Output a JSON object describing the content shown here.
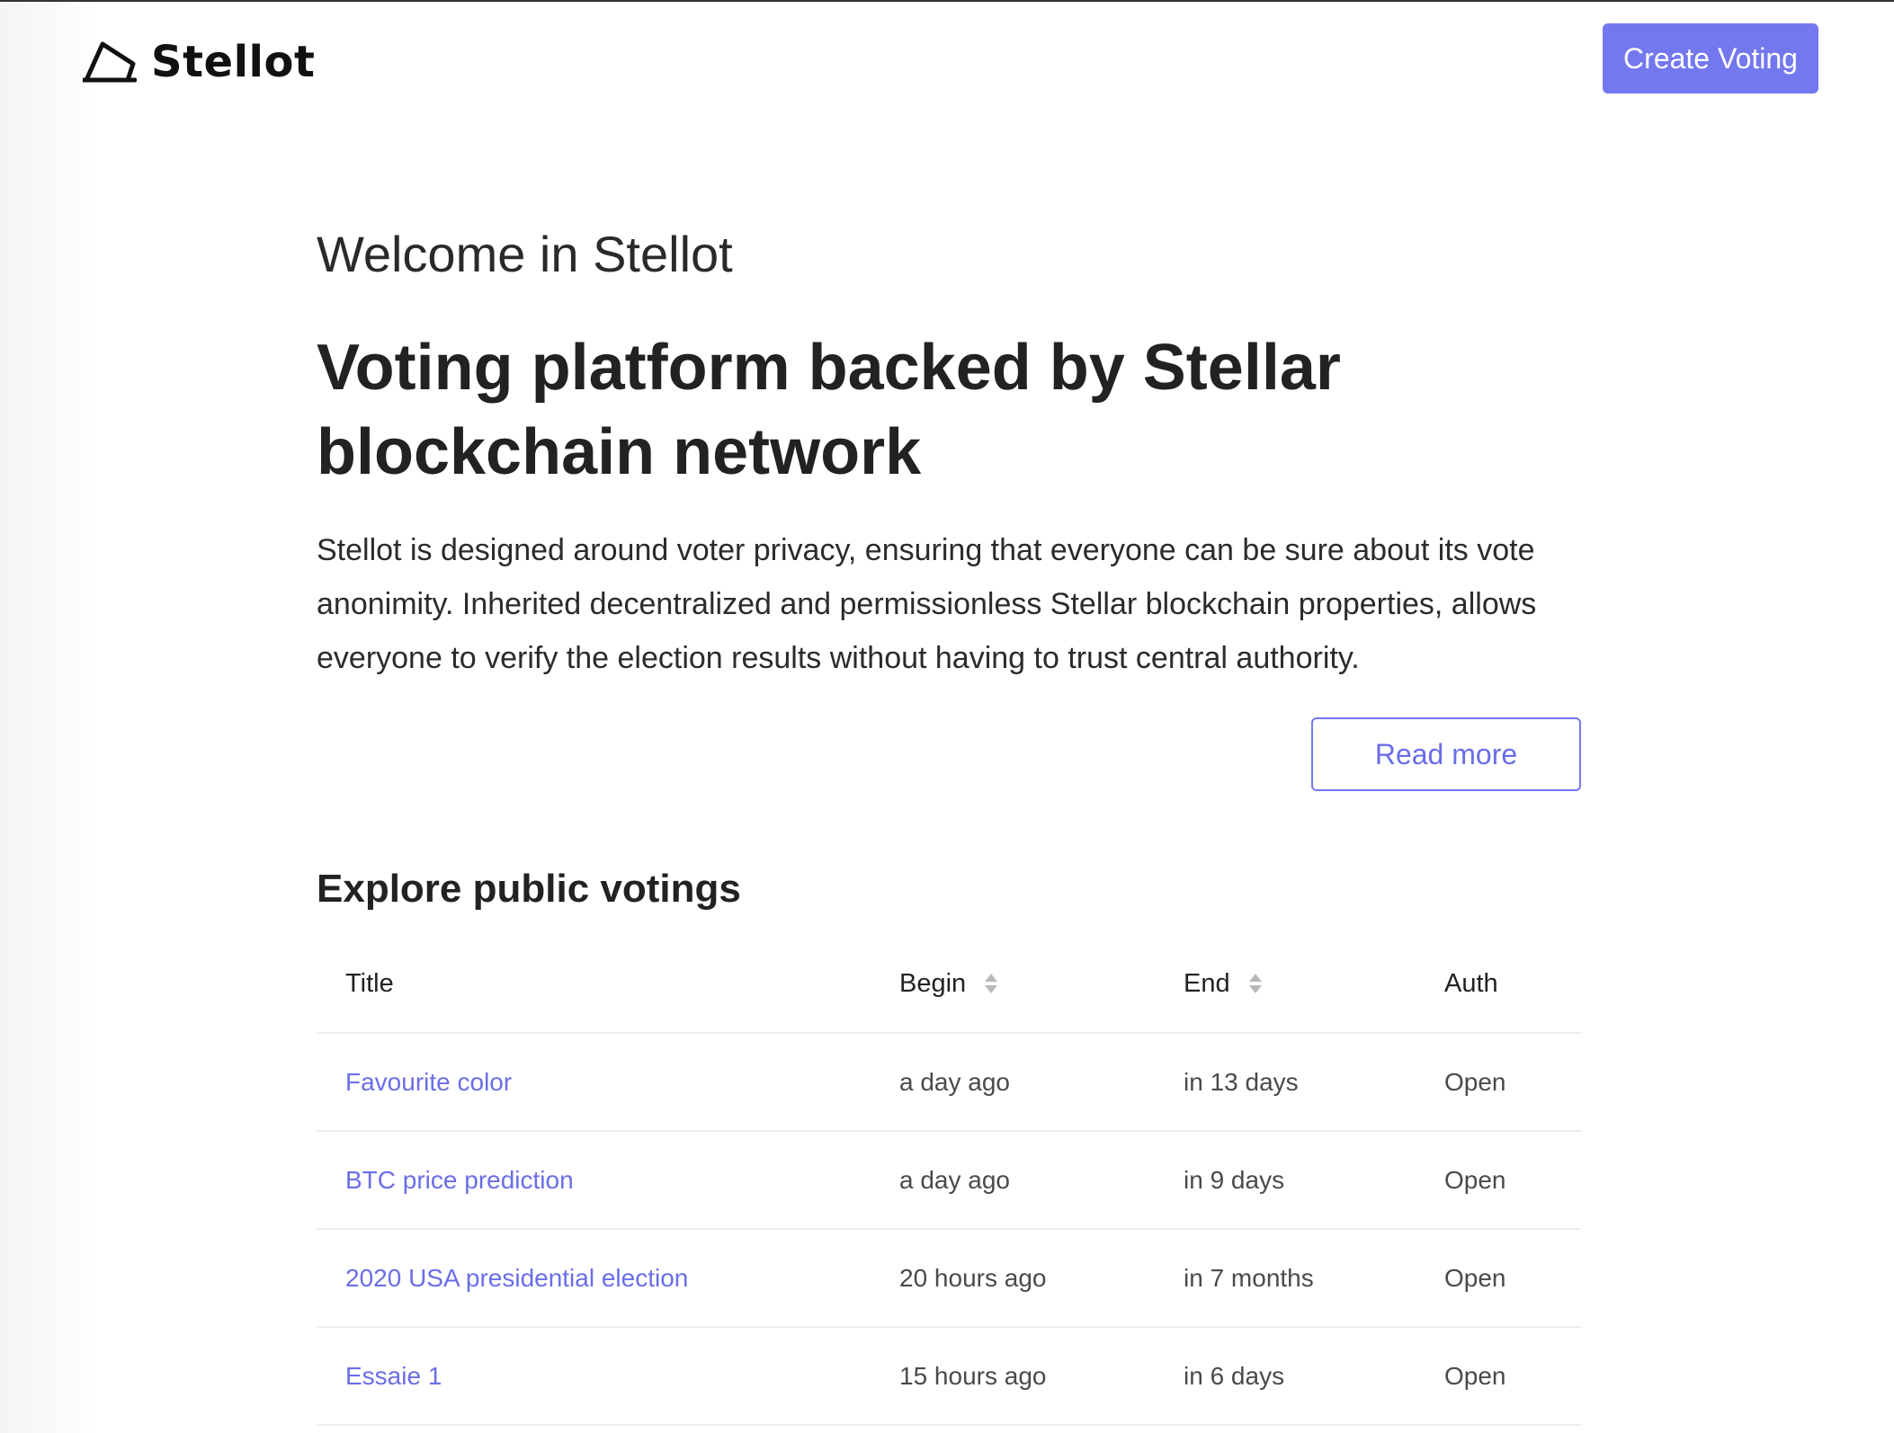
{
  "header": {
    "brand": "Stellot",
    "create_button": "Create Voting"
  },
  "hero": {
    "welcome": "Welcome in Stellot",
    "headline": "Voting platform backed by Stellar blockchain network",
    "description": "Stellot is designed around voter privacy, ensuring that everyone can be sure about its vote anonimity. Inherited decentralized and permissionless Stellar blockchain properties, allows everyone to verify the election results without having to trust central authority.",
    "read_more": "Read more"
  },
  "votings": {
    "title": "Explore public votings",
    "columns": {
      "title": "Title",
      "begin": "Begin",
      "end": "End",
      "auth": "Auth"
    },
    "rows": [
      {
        "title": "Favourite color",
        "begin": "a day ago",
        "end": "in 13 days",
        "auth": "Open"
      },
      {
        "title": "BTC price prediction",
        "begin": "a day ago",
        "end": "in 9 days",
        "auth": "Open"
      },
      {
        "title": "2020 USA presidential election",
        "begin": "20 hours ago",
        "end": "in 7 months",
        "auth": "Open"
      },
      {
        "title": "Essaie 1",
        "begin": "15 hours ago",
        "end": "in 6 days",
        "auth": "Open"
      }
    ]
  },
  "colors": {
    "accent": "#7478ee",
    "link": "#6a6ee6",
    "text": "#222222",
    "divider": "#ececec"
  },
  "icons": {
    "logo": "stellot-parallelogram-logo",
    "sort": "sort-updown-icon"
  }
}
